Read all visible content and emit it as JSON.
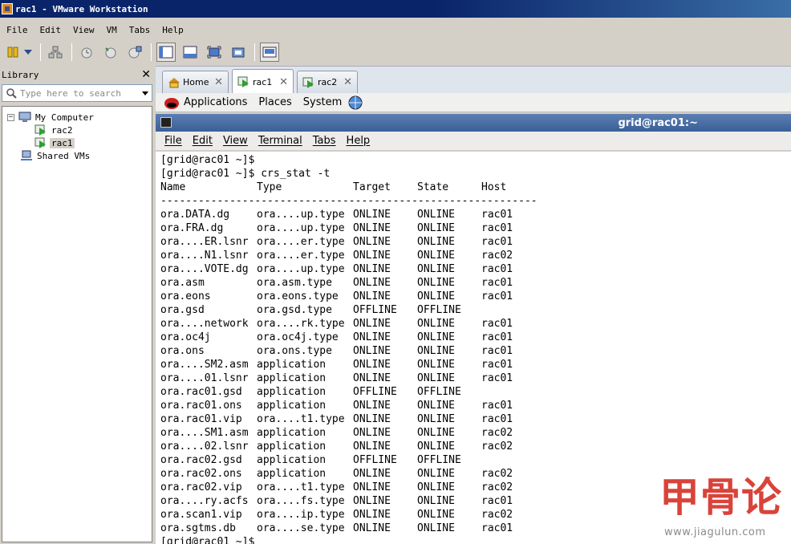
{
  "window": {
    "title": "rac1 - VMware Workstation"
  },
  "menubar": {
    "items": [
      "File",
      "Edit",
      "View",
      "VM",
      "Tabs",
      "Help"
    ]
  },
  "toolbar": {
    "buttons": [
      "pause-icon",
      "dropdown-arrow-icon",
      "network-icon",
      "snapshot-icon",
      "revert-snapshot-icon",
      "snapshot-manager-icon",
      "console-view-icon",
      "quick-switch-icon",
      "full-screen-icon",
      "unity-icon",
      "thumbnail-bar-icon"
    ]
  },
  "library": {
    "title": "Library",
    "search_placeholder": "Type here to search",
    "tree": {
      "root": "My Computer",
      "vms": [
        "rac2",
        "rac1"
      ],
      "shared": "Shared VMs",
      "selected": "rac1"
    }
  },
  "tabs": [
    {
      "label": "Home",
      "active": false
    },
    {
      "label": "rac1",
      "active": true
    },
    {
      "label": "rac2",
      "active": false
    }
  ],
  "guest_panel": {
    "items": [
      "Applications",
      "Places",
      "System"
    ]
  },
  "terminal": {
    "title": "grid@rac01:~",
    "menu": [
      "File",
      "Edit",
      "View",
      "Terminal",
      "Tabs",
      "Help"
    ],
    "prompt1": "[grid@rac01 ~]$",
    "prompt2": "[grid@rac01 ~]$ crs_stat -t",
    "headers": [
      "Name",
      "Type",
      "Target",
      "State",
      "Host"
    ],
    "separator": "------------------------------------------------------------",
    "rows": [
      [
        "ora.DATA.dg",
        "ora....up.type",
        "ONLINE",
        "ONLINE",
        "rac01"
      ],
      [
        "ora.FRA.dg",
        "ora....up.type",
        "ONLINE",
        "ONLINE",
        "rac01"
      ],
      [
        "ora....ER.lsnr",
        "ora....er.type",
        "ONLINE",
        "ONLINE",
        "rac01"
      ],
      [
        "ora....N1.lsnr",
        "ora....er.type",
        "ONLINE",
        "ONLINE",
        "rac02"
      ],
      [
        "ora....VOTE.dg",
        "ora....up.type",
        "ONLINE",
        "ONLINE",
        "rac01"
      ],
      [
        "ora.asm",
        "ora.asm.type",
        "ONLINE",
        "ONLINE",
        "rac01"
      ],
      [
        "ora.eons",
        "ora.eons.type",
        "ONLINE",
        "ONLINE",
        "rac01"
      ],
      [
        "ora.gsd",
        "ora.gsd.type",
        "OFFLINE",
        "OFFLINE",
        ""
      ],
      [
        "ora....network",
        "ora....rk.type",
        "ONLINE",
        "ONLINE",
        "rac01"
      ],
      [
        "ora.oc4j",
        "ora.oc4j.type",
        "ONLINE",
        "ONLINE",
        "rac01"
      ],
      [
        "ora.ons",
        "ora.ons.type",
        "ONLINE",
        "ONLINE",
        "rac01"
      ],
      [
        "ora....SM2.asm",
        "application",
        "ONLINE",
        "ONLINE",
        "rac01"
      ],
      [
        "ora....01.lsnr",
        "application",
        "ONLINE",
        "ONLINE",
        "rac01"
      ],
      [
        "ora.rac01.gsd",
        "application",
        "OFFLINE",
        "OFFLINE",
        ""
      ],
      [
        "ora.rac01.ons",
        "application",
        "ONLINE",
        "ONLINE",
        "rac01"
      ],
      [
        "ora.rac01.vip",
        "ora....t1.type",
        "ONLINE",
        "ONLINE",
        "rac01"
      ],
      [
        "ora....SM1.asm",
        "application",
        "ONLINE",
        "ONLINE",
        "rac02"
      ],
      [
        "ora....02.lsnr",
        "application",
        "ONLINE",
        "ONLINE",
        "rac02"
      ],
      [
        "ora.rac02.gsd",
        "application",
        "OFFLINE",
        "OFFLINE",
        ""
      ],
      [
        "ora.rac02.ons",
        "application",
        "ONLINE",
        "ONLINE",
        "rac02"
      ],
      [
        "ora.rac02.vip",
        "ora....t1.type",
        "ONLINE",
        "ONLINE",
        "rac02"
      ],
      [
        "ora....ry.acfs",
        "ora....fs.type",
        "ONLINE",
        "ONLINE",
        "rac01"
      ],
      [
        "ora.scan1.vip",
        "ora....ip.type",
        "ONLINE",
        "ONLINE",
        "rac02"
      ],
      [
        "ora.sgtms.db",
        "ora....se.type",
        "ONLINE",
        "ONLINE",
        "rac01"
      ]
    ],
    "prompt_end": "[grid@rac01 ~]$"
  },
  "watermark": {
    "logo": "甲骨论",
    "url": "www.jiagulun.com"
  },
  "colors": {
    "titlebar": "#0a246a",
    "terminal_title": "#4a6fa5",
    "watermark": "#d9433a"
  }
}
